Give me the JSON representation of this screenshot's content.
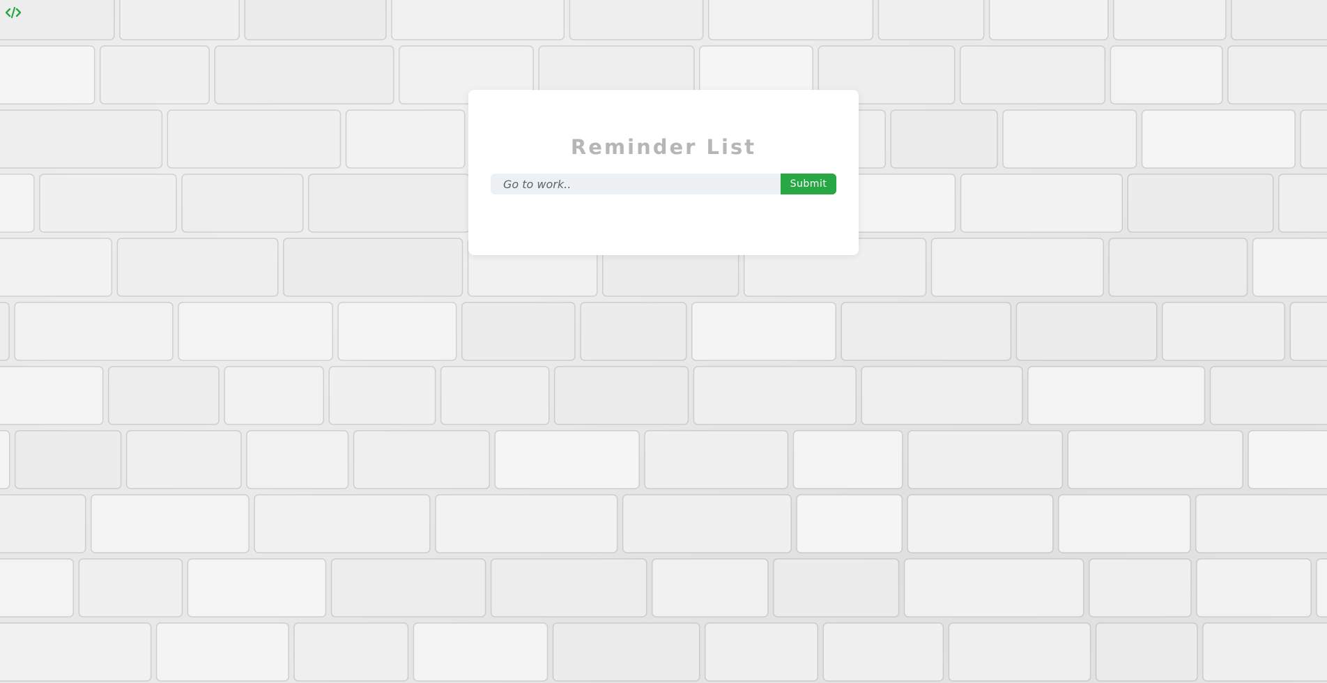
{
  "background": {
    "image": "white-brick-wall"
  },
  "corner_logo": {
    "icon": "code-icon",
    "color": "#28a745"
  },
  "card": {
    "title": "Reminder List",
    "input": {
      "value": "",
      "placeholder": "Go to work.."
    },
    "submit_label": "Submit",
    "accent_color": "#28a745"
  }
}
